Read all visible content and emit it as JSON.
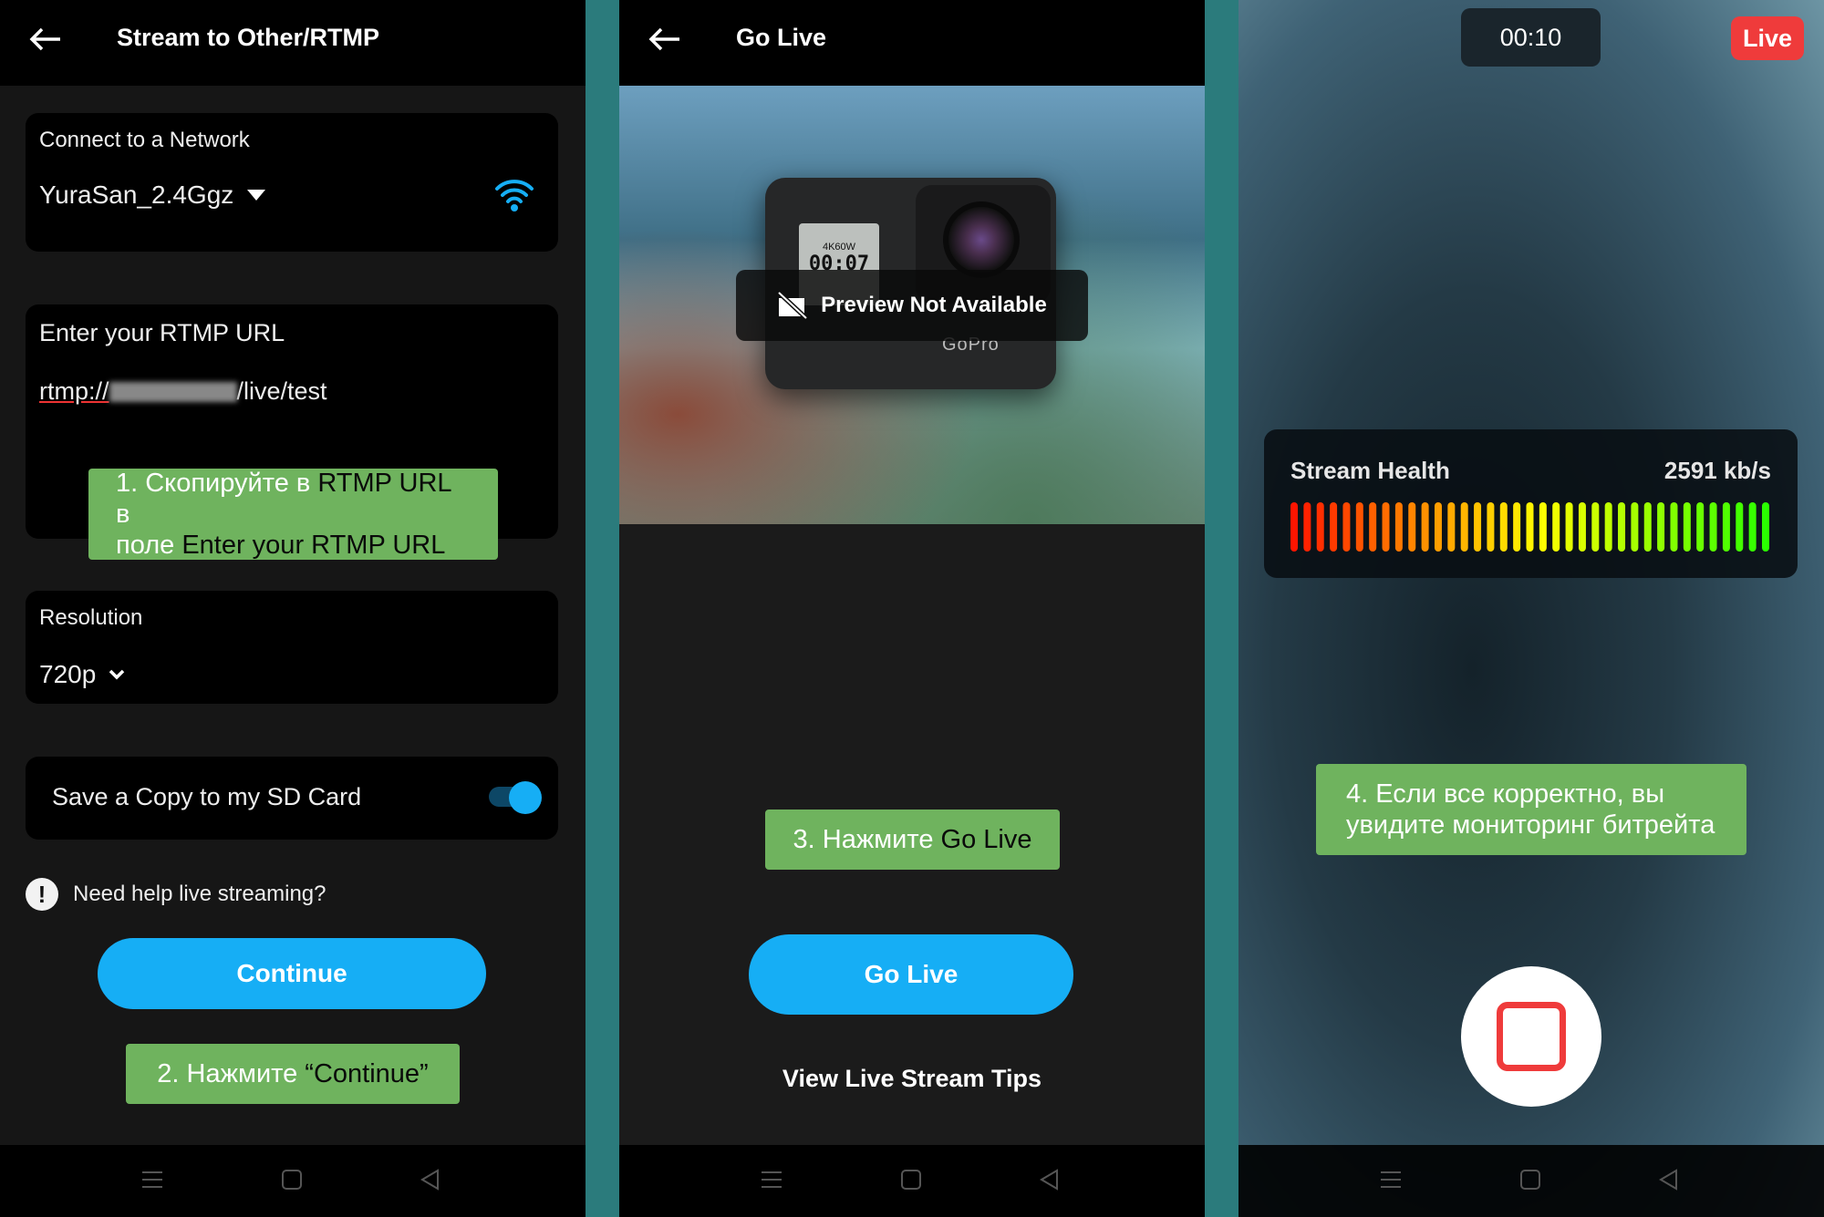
{
  "screen1": {
    "title": "Stream to Other/RTMP",
    "network": {
      "label": "Connect to a Network",
      "value": "YuraSan_2.4Ggz"
    },
    "rtmp": {
      "label": "Enter your RTMP URL",
      "url_prefix": "rtmp://",
      "url_suffix": "/live/test"
    },
    "resolution": {
      "label": "Resolution",
      "value": "720p"
    },
    "sd_card": {
      "label": "Save a Copy to my SD Card",
      "enabled": true
    },
    "help_text": "Need help live streaming?",
    "continue_label": "Continue",
    "note1": {
      "line1": [
        {
          "t": "1. Скопируйте в ",
          "k": false
        },
        {
          "t": "RTMP URL",
          "k": true
        },
        {
          "t": " в",
          "k": false
        }
      ],
      "line2": [
        {
          "t": "поле ",
          "k": false
        },
        {
          "t": "Enter your RTMP URL",
          "k": true
        }
      ]
    },
    "note2": [
      {
        "t": "2. Нажмите ",
        "k": false
      },
      {
        "t": "“Continue”",
        "k": true
      }
    ]
  },
  "screen2": {
    "title": "Go Live",
    "preview_text": "Preview Not Available",
    "camera": {
      "lcd_mode": "4K60W",
      "lcd_time": "00:07",
      "brand": "GoPro"
    },
    "note3": [
      {
        "t": "3. Нажмите ",
        "k": false
      },
      {
        "t": "Go Live",
        "k": true
      }
    ],
    "go_live_label": "Go Live",
    "tips_label": "View Live Stream Tips"
  },
  "screen3": {
    "timer": "00:10",
    "live_badge": "Live",
    "health": {
      "label": "Stream Health",
      "bitrate": "2591 kb/s",
      "segments": 37,
      "level": 1.0
    },
    "note4": {
      "line1": "4. Если все корректно, вы",
      "line2": "увидите мониторинг битрейта"
    }
  },
  "colors": {
    "accent": "#16aef5",
    "live": "#ef3b3b",
    "note": "#6fb35e",
    "stop": "#ef3b3b"
  }
}
